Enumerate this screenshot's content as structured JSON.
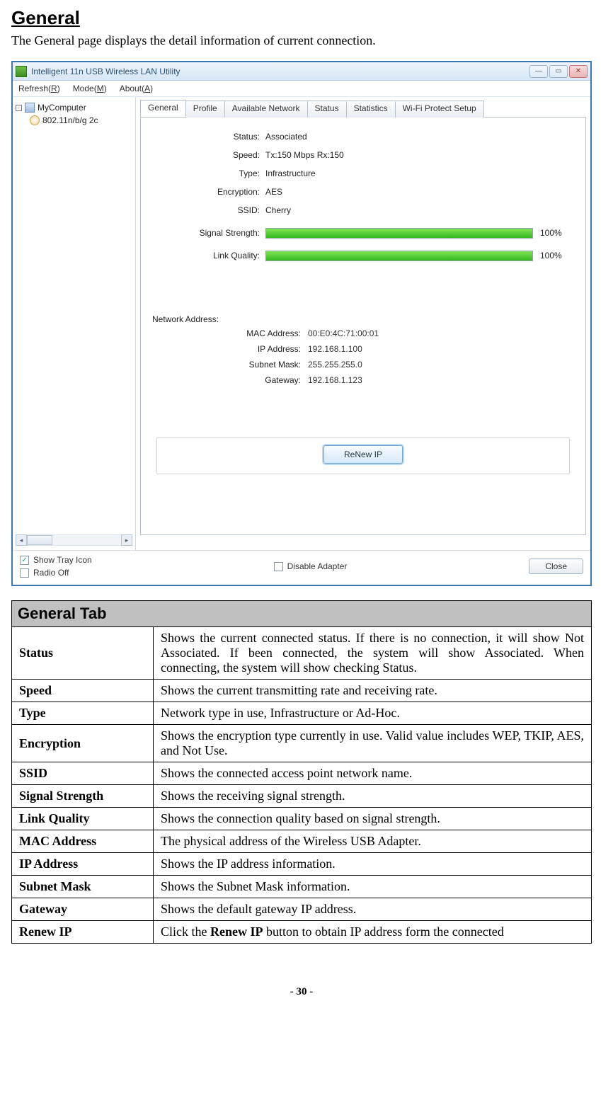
{
  "heading": "General",
  "intro": "The General page displays the detail information of current connection.",
  "window": {
    "title": "Intelligent 11n USB Wireless LAN Utility",
    "menu": {
      "refresh_pre": "Refresh(",
      "refresh_u": "R",
      "refresh_post": ")",
      "mode_pre": "Mode(",
      "mode_u": "M",
      "mode_post": ")",
      "about_pre": "About(",
      "about_u": "A",
      "about_post": ")"
    },
    "tree": {
      "root": "MyComputer",
      "adapter": "802.11n/b/g 2c"
    },
    "tabs": {
      "general": "General",
      "profile": "Profile",
      "available": "Available Network",
      "status": "Status",
      "statistics": "Statistics",
      "wps": "Wi-Fi Protect Setup"
    },
    "fields": {
      "status_label": "Status:",
      "status_value": "Associated",
      "speed_label": "Speed:",
      "speed_value": "Tx:150 Mbps Rx:150",
      "type_label": "Type:",
      "type_value": "Infrastructure",
      "enc_label": "Encryption:",
      "enc_value": "AES",
      "ssid_label": "SSID:",
      "ssid_value": "Cherry",
      "signal_label": "Signal Strength:",
      "signal_pct": "100%",
      "link_label": "Link Quality:",
      "link_pct": "100%"
    },
    "network_address": {
      "section": "Network Address:",
      "mac_label": "MAC Address:",
      "mac_value": "00:E0:4C:71:00:01",
      "ip_label": "IP Address:",
      "ip_value": "192.168.1.100",
      "mask_label": "Subnet Mask:",
      "mask_value": "255.255.255.0",
      "gw_label": "Gateway:",
      "gw_value": "192.168.1.123"
    },
    "renew_btn": "ReNew IP",
    "footer": {
      "show_tray": "Show Tray Icon",
      "radio_off": "Radio Off",
      "disable_adapter": "Disable Adapter",
      "close": "Close"
    }
  },
  "def_table": {
    "header": "General Tab",
    "rows": {
      "status_k": "Status",
      "status_v": "Shows the current connected status. If there is no connection, it will show Not Associated. If been connected, the system will show Associated. When connecting, the system will show checking Status.",
      "speed_k": "Speed",
      "speed_v": "Shows the current transmitting rate and receiving rate.",
      "type_k": "Type",
      "type_v": "Network type in use, Infrastructure or Ad-Hoc.",
      "enc_k": "Encryption",
      "enc_v": "Shows the encryption type currently in use. Valid value includes WEP, TKIP, AES, and Not Use.",
      "ssid_k": "SSID",
      "ssid_v": "Shows the connected access point network name.",
      "sig_k": "Signal Strength",
      "sig_v": "Shows the receiving signal strength.",
      "lq_k": "Link Quality",
      "lq_v": "Shows the connection quality based on signal strength.",
      "mac_k": "MAC Address",
      "mac_v": "The physical address of the Wireless USB Adapter.",
      "ip_k": "IP Address",
      "ip_v": "Shows the IP address information.",
      "mask_k": "Subnet Mask",
      "mask_v": "Shows the Subnet Mask information.",
      "gw_k": "Gateway",
      "gw_v": "Shows the default gateway IP address.",
      "renew_k": "Renew IP",
      "renew_pre": "Click the ",
      "renew_bold": "Renew IP",
      "renew_post": " button to obtain IP address form the connected"
    }
  },
  "page_number": "- 30 -"
}
